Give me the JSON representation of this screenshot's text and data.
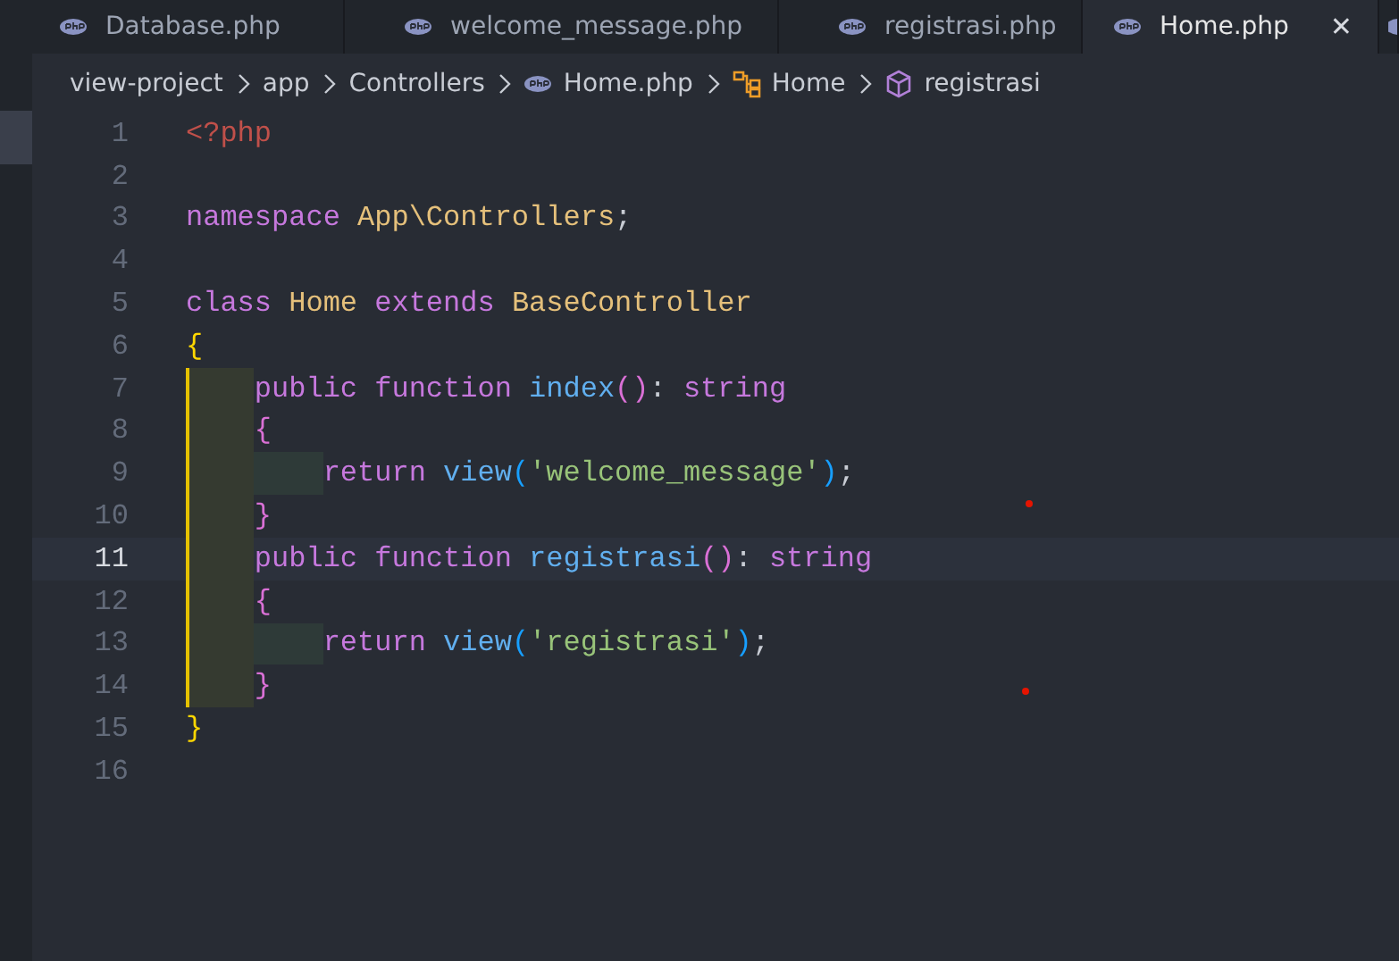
{
  "tabs": [
    {
      "label": "Database.php",
      "selected": false
    },
    {
      "label": "welcome_message.php",
      "selected": false
    },
    {
      "label": "registrasi.php",
      "selected": false
    },
    {
      "label": "Home.php",
      "selected": true,
      "close": "✕"
    }
  ],
  "breadcrumbs": [
    {
      "label": "view-project",
      "kind": "folder"
    },
    {
      "label": "app",
      "kind": "folder"
    },
    {
      "label": "Controllers",
      "kind": "folder"
    },
    {
      "label": "Home.php",
      "kind": "file"
    },
    {
      "label": "Home",
      "kind": "class"
    },
    {
      "label": "registrasi",
      "kind": "method"
    }
  ],
  "editor": {
    "lines": [
      {
        "number": "1",
        "current": false,
        "tokens": [
          {
            "kind": "tag",
            "text": "<?php"
          }
        ]
      },
      {
        "number": "2",
        "current": false
      },
      {
        "number": "3",
        "current": false,
        "tokens": [
          {
            "kind": "keyword",
            "text": "namespace "
          },
          {
            "kind": "type",
            "text": "App\\Controllers"
          },
          {
            "kind": "punct",
            "text": ";"
          }
        ]
      },
      {
        "number": "4",
        "current": false
      },
      {
        "number": "5",
        "current": false,
        "tokens": [
          {
            "kind": "keyword",
            "text": "class "
          },
          {
            "kind": "type",
            "text": "Home "
          },
          {
            "kind": "keyword",
            "text": "extends "
          },
          {
            "kind": "type",
            "text": "BaseController"
          }
        ]
      },
      {
        "number": "6",
        "current": false,
        "tokens": [
          {
            "kind": "brace1",
            "text": "{"
          }
        ]
      },
      {
        "number": "7",
        "current": false,
        "guides": [
          {
            "active": true
          }
        ],
        "tokens": [
          {
            "kind": "keyword",
            "text": "public function "
          },
          {
            "kind": "function",
            "text": "index"
          },
          {
            "kind": "brace2",
            "text": "()"
          },
          {
            "kind": "punct",
            "text": ": "
          },
          {
            "kind": "keyword",
            "text": "string"
          }
        ]
      },
      {
        "number": "8",
        "current": false,
        "guides": [
          {
            "active": true
          }
        ],
        "tokens": [
          {
            "kind": "brace2",
            "text": "{"
          }
        ]
      },
      {
        "number": "9",
        "current": false,
        "guides": [
          {
            "active": true
          },
          {
            "active": false
          }
        ],
        "tokens": [
          {
            "kind": "keyword",
            "text": "return "
          },
          {
            "kind": "function",
            "text": "view"
          },
          {
            "kind": "brace3",
            "text": "("
          },
          {
            "kind": "string",
            "text": "'welcome_message'"
          },
          {
            "kind": "brace3",
            "text": ")"
          },
          {
            "kind": "punct",
            "text": ";"
          }
        ]
      },
      {
        "number": "10",
        "current": false,
        "guides": [
          {
            "active": true
          }
        ],
        "tokens": [
          {
            "kind": "brace2",
            "text": "}"
          }
        ]
      },
      {
        "number": "11",
        "current": true,
        "guides": [
          {
            "active": true
          }
        ],
        "tokens": [
          {
            "kind": "keyword",
            "text": "public function "
          },
          {
            "kind": "function",
            "text": "registrasi"
          },
          {
            "kind": "brace2",
            "text": "()"
          },
          {
            "kind": "punct",
            "text": ": "
          },
          {
            "kind": "keyword",
            "text": "string"
          }
        ]
      },
      {
        "number": "12",
        "current": false,
        "guides": [
          {
            "active": true
          }
        ],
        "tokens": [
          {
            "kind": "brace2",
            "text": "{"
          }
        ]
      },
      {
        "number": "13",
        "current": false,
        "guides": [
          {
            "active": true
          },
          {
            "active": false
          }
        ],
        "tokens": [
          {
            "kind": "keyword",
            "text": "return "
          },
          {
            "kind": "function",
            "text": "view"
          },
          {
            "kind": "brace3",
            "text": "("
          },
          {
            "kind": "string",
            "text": "'registrasi'"
          },
          {
            "kind": "brace3",
            "text": ")"
          },
          {
            "kind": "punct",
            "text": ";"
          }
        ]
      },
      {
        "number": "14",
        "current": false,
        "guides": [
          {
            "active": true
          }
        ],
        "tokens": [
          {
            "kind": "brace2",
            "text": "}"
          }
        ]
      },
      {
        "number": "15",
        "current": false,
        "tokens": [
          {
            "kind": "brace1",
            "text": "}"
          }
        ]
      },
      {
        "number": "16",
        "current": false
      }
    ]
  }
}
